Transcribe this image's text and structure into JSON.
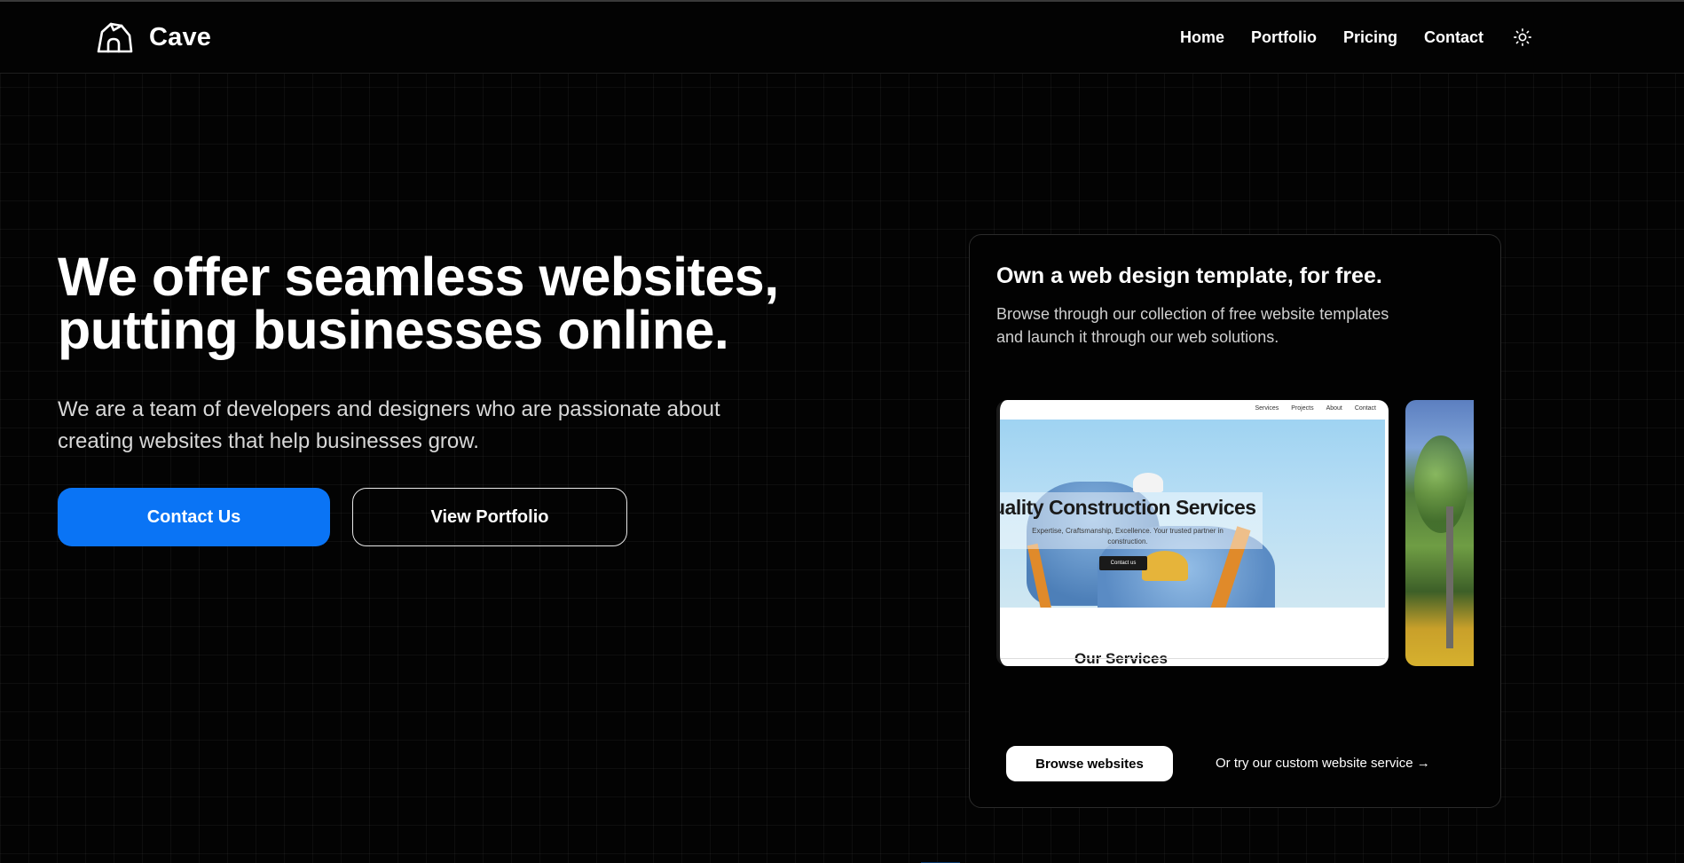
{
  "brand": {
    "name": "Cave"
  },
  "nav": {
    "items": [
      {
        "label": "Home"
      },
      {
        "label": "Portfolio"
      },
      {
        "label": "Pricing"
      },
      {
        "label": "Contact"
      }
    ],
    "theme_icon": "sun-icon"
  },
  "hero": {
    "title_line1": "We offer seamless websites,",
    "title_line2": "putting businesses online.",
    "subtitle_line1": "We are a team of developers and designers who are passionate about",
    "subtitle_line2": "creating websites that help businesses grow.",
    "primary_button": "Contact Us",
    "secondary_button": "View Portfolio"
  },
  "template_card": {
    "title": "Own a web design template, for free.",
    "description_line1": "Browse through our collection of free website templates",
    "description_line2": "and launch it through our web solutions.",
    "preview": {
      "nav_items": [
        "Services",
        "Projects",
        "About",
        "Contact"
      ],
      "headline": "uality Construction Services",
      "description": "Expertise, Craftsmanship, Excellence. Your trusted partner in construction.",
      "button": "Contact us",
      "section_title": "Our Services"
    },
    "browse_button": "Browse websites",
    "custom_link": "Or try our custom website service →"
  },
  "colors": {
    "accent": "#0a74f5",
    "background": "#030303"
  }
}
